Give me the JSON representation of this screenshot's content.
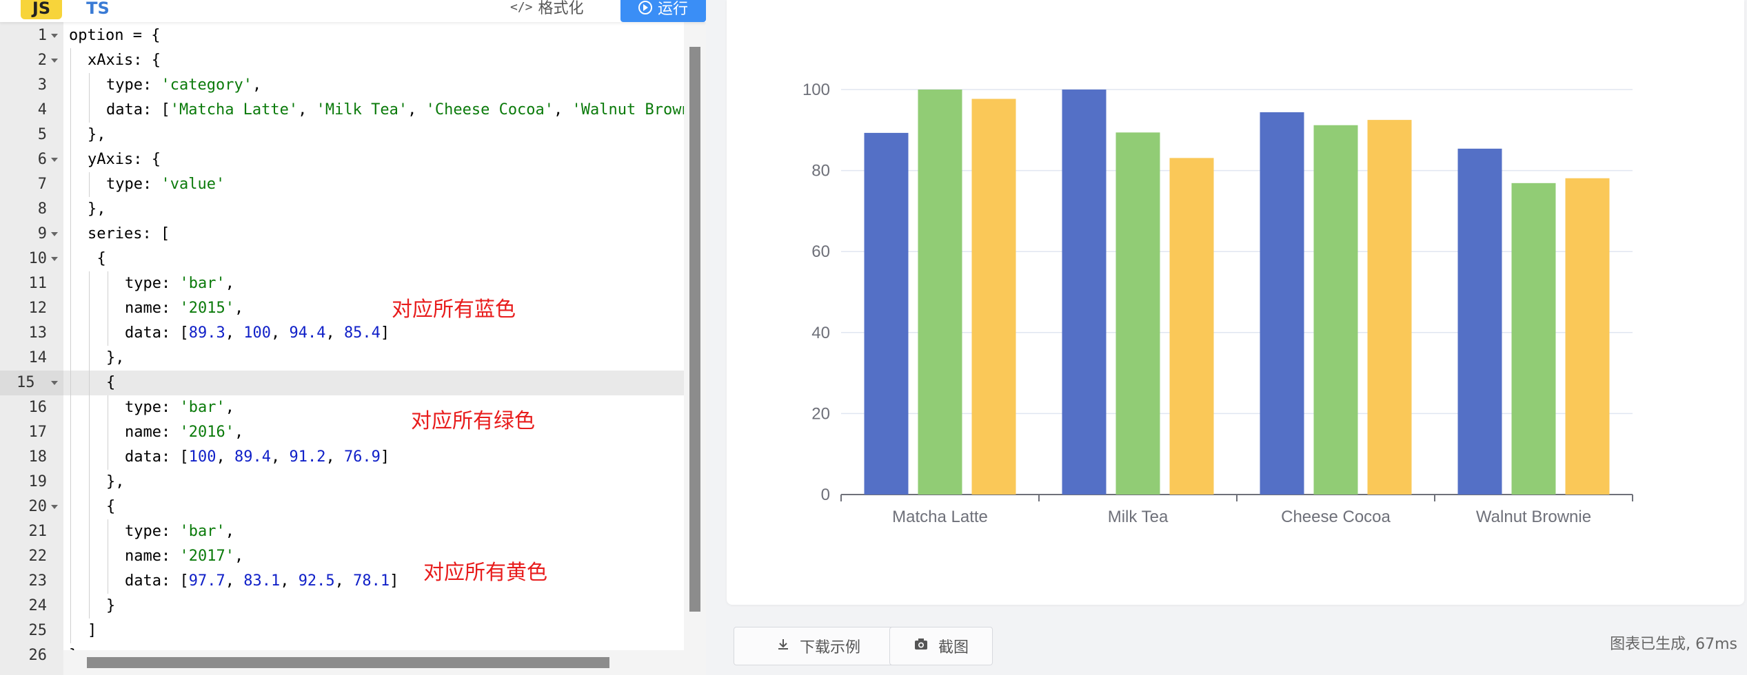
{
  "toolbar": {
    "tab_js": "JS",
    "tab_ts": "TS",
    "format_label": "格式化",
    "run_label": "运行"
  },
  "editor": {
    "active_line": 15,
    "lines": [
      {
        "n": "1",
        "fold": true,
        "indent": 0,
        "tokens": [
          [
            "p",
            "option = {"
          ]
        ]
      },
      {
        "n": "2",
        "fold": true,
        "indent": 1,
        "tokens": [
          [
            "p",
            "xAxis: {"
          ]
        ]
      },
      {
        "n": "3",
        "fold": false,
        "indent": 2,
        "tokens": [
          [
            "p",
            "type: "
          ],
          [
            "s",
            "'category'"
          ],
          [
            "p",
            ","
          ]
        ]
      },
      {
        "n": "4",
        "fold": false,
        "indent": 2,
        "tokens": [
          [
            "p",
            "data: ["
          ],
          [
            "s",
            "'Matcha Latte'"
          ],
          [
            "p",
            ", "
          ],
          [
            "s",
            "'Milk Tea'"
          ],
          [
            "p",
            ", "
          ],
          [
            "s",
            "'Cheese Cocoa'"
          ],
          [
            "p",
            ", "
          ],
          [
            "s",
            "'Walnut Brown"
          ]
        ]
      },
      {
        "n": "5",
        "fold": false,
        "indent": 1,
        "tokens": [
          [
            "p",
            "},"
          ]
        ]
      },
      {
        "n": "6",
        "fold": true,
        "indent": 1,
        "tokens": [
          [
            "p",
            "yAxis: {"
          ]
        ]
      },
      {
        "n": "7",
        "fold": false,
        "indent": 2,
        "tokens": [
          [
            "p",
            "type: "
          ],
          [
            "s",
            "'value'"
          ]
        ]
      },
      {
        "n": "8",
        "fold": false,
        "indent": 1,
        "tokens": [
          [
            "p",
            "},"
          ]
        ]
      },
      {
        "n": "9",
        "fold": true,
        "indent": 1,
        "tokens": [
          [
            "p",
            "series: ["
          ]
        ]
      },
      {
        "n": "10",
        "fold": true,
        "indent": 1.5,
        "tokens": [
          [
            "p",
            "{"
          ]
        ]
      },
      {
        "n": "11",
        "fold": false,
        "indent": 3,
        "tokens": [
          [
            "p",
            "type: "
          ],
          [
            "s",
            "'bar'"
          ],
          [
            "p",
            ","
          ]
        ]
      },
      {
        "n": "12",
        "fold": false,
        "indent": 3,
        "tokens": [
          [
            "p",
            "name: "
          ],
          [
            "s",
            "'2015'"
          ],
          [
            "p",
            ","
          ]
        ]
      },
      {
        "n": "13",
        "fold": false,
        "indent": 3,
        "tokens": [
          [
            "p",
            "data: ["
          ],
          [
            "n",
            "89.3"
          ],
          [
            "p",
            ", "
          ],
          [
            "n",
            "100"
          ],
          [
            "p",
            ", "
          ],
          [
            "n",
            "94.4"
          ],
          [
            "p",
            ", "
          ],
          [
            "n",
            "85.4"
          ],
          [
            "p",
            "]"
          ]
        ]
      },
      {
        "n": "14",
        "fold": false,
        "indent": 2,
        "tokens": [
          [
            "p",
            "},"
          ]
        ]
      },
      {
        "n": "15",
        "fold": true,
        "indent": 2,
        "tokens": [
          [
            "p",
            "{"
          ]
        ]
      },
      {
        "n": "16",
        "fold": false,
        "indent": 3,
        "tokens": [
          [
            "p",
            "type: "
          ],
          [
            "s",
            "'bar'"
          ],
          [
            "p",
            ","
          ]
        ]
      },
      {
        "n": "17",
        "fold": false,
        "indent": 3,
        "tokens": [
          [
            "p",
            "name: "
          ],
          [
            "s",
            "'2016'"
          ],
          [
            "p",
            ","
          ]
        ]
      },
      {
        "n": "18",
        "fold": false,
        "indent": 3,
        "tokens": [
          [
            "p",
            "data: ["
          ],
          [
            "n",
            "100"
          ],
          [
            "p",
            ", "
          ],
          [
            "n",
            "89.4"
          ],
          [
            "p",
            ", "
          ],
          [
            "n",
            "91.2"
          ],
          [
            "p",
            ", "
          ],
          [
            "n",
            "76.9"
          ],
          [
            "p",
            "]"
          ]
        ]
      },
      {
        "n": "19",
        "fold": false,
        "indent": 2,
        "tokens": [
          [
            "p",
            "},"
          ]
        ]
      },
      {
        "n": "20",
        "fold": true,
        "indent": 2,
        "tokens": [
          [
            "p",
            "{"
          ]
        ]
      },
      {
        "n": "21",
        "fold": false,
        "indent": 3,
        "tokens": [
          [
            "p",
            "type: "
          ],
          [
            "s",
            "'bar'"
          ],
          [
            "p",
            ","
          ]
        ]
      },
      {
        "n": "22",
        "fold": false,
        "indent": 3,
        "tokens": [
          [
            "p",
            "name: "
          ],
          [
            "s",
            "'2017'"
          ],
          [
            "p",
            ","
          ]
        ]
      },
      {
        "n": "23",
        "fold": false,
        "indent": 3,
        "tokens": [
          [
            "p",
            "data: ["
          ],
          [
            "n",
            "97.7"
          ],
          [
            "p",
            ", "
          ],
          [
            "n",
            "83.1"
          ],
          [
            "p",
            ", "
          ],
          [
            "n",
            "92.5"
          ],
          [
            "p",
            ", "
          ],
          [
            "n",
            "78.1"
          ],
          [
            "p",
            "]"
          ]
        ]
      },
      {
        "n": "24",
        "fold": false,
        "indent": 2,
        "tokens": [
          [
            "p",
            "}"
          ]
        ]
      },
      {
        "n": "25",
        "fold": false,
        "indent": 1,
        "tokens": [
          [
            "p",
            "]"
          ]
        ]
      },
      {
        "n": "26",
        "fold": false,
        "indent": 0,
        "tokens": [
          [
            "p",
            "}"
          ]
        ]
      }
    ],
    "annotations": {
      "blue": "对应所有蓝色",
      "green": "对应所有绿色",
      "yellow": "对应所有黄色"
    }
  },
  "chart_data": {
    "type": "bar",
    "categories": [
      "Matcha Latte",
      "Milk Tea",
      "Cheese Cocoa",
      "Walnut Brownie"
    ],
    "series": [
      {
        "values": [
          89.3,
          100,
          94.4,
          85.4
        ],
        "color": "#5470c6"
      },
      {
        "values": [
          100,
          89.4,
          91.2,
          76.9
        ],
        "color": "#91cc75"
      },
      {
        "values": [
          97.7,
          83.1,
          92.5,
          78.1
        ],
        "color": "#fac858"
      }
    ],
    "ylim": [
      0,
      100
    ],
    "yticks": [
      "0",
      "20",
      "40",
      "60",
      "80",
      "100"
    ],
    "grid": true
  },
  "actions": {
    "download_label": "下载示例",
    "screenshot_label": "截图",
    "status": "图表已生成, 67ms"
  }
}
